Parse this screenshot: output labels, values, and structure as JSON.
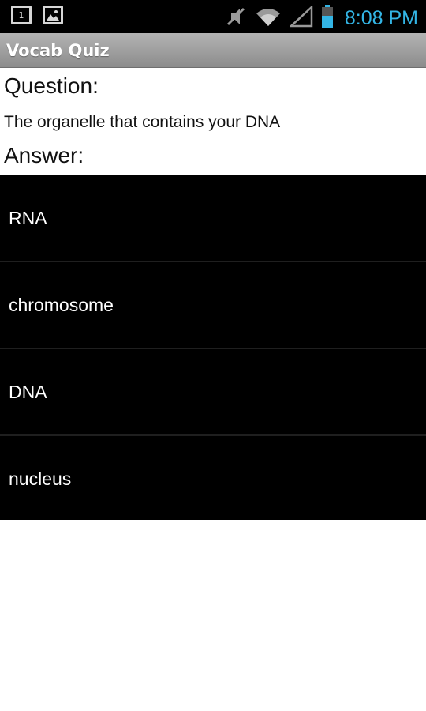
{
  "status_bar": {
    "left_icons": [
      "notification-1-icon",
      "gallery-icon"
    ],
    "notification_count": "1",
    "right_icons": [
      "mute-icon",
      "wifi-icon",
      "signal-icon",
      "battery-icon"
    ],
    "time": "8:08 PM",
    "time_color": "#33b5e5"
  },
  "app": {
    "title": "Vocab Quiz"
  },
  "quiz": {
    "question_label": "Question:",
    "question_text": "The organelle that contains your DNA",
    "answer_label": "Answer:",
    "answers": [
      {
        "label": "RNA"
      },
      {
        "label": "chromosome"
      },
      {
        "label": "DNA"
      },
      {
        "label": "nucleus"
      }
    ]
  }
}
